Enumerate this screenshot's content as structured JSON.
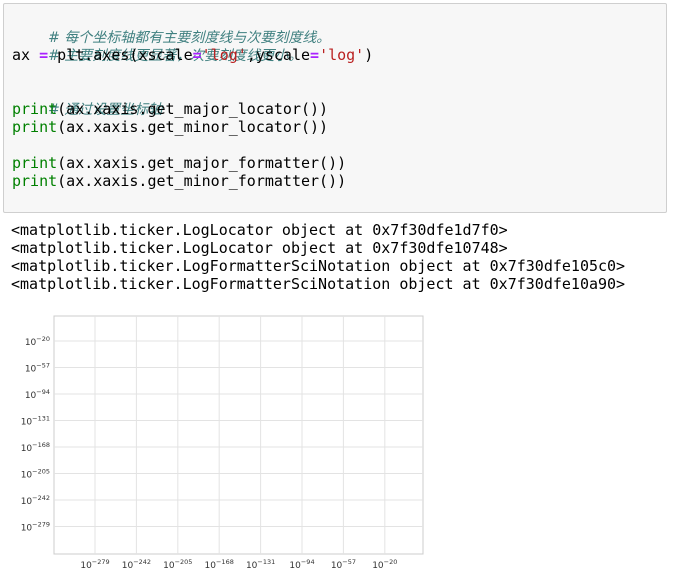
{
  "code": {
    "comment1": "# 每个坐标轴都有主要刻度线与次要刻度线。",
    "comment2": "# 主要刻度线更显著，次要刻度线更小。",
    "line3_a": "ax ",
    "line3_eq": "=",
    "line3_b": " plt.axes(xscale",
    "line3_eq2": "=",
    "line3_s1": "'log'",
    "line3_c": ",yscale",
    "line3_eq3": "=",
    "line3_s2": "'log'",
    "line3_d": ")",
    "comment3": "# 通过设置坐标轴",
    "print_kw": "print",
    "p1_rest": "(ax.xaxis.get_major_locator())",
    "p2_rest": "(ax.xaxis.get_minor_locator())",
    "p3_rest": "(ax.xaxis.get_major_formatter())",
    "p4_rest": "(ax.xaxis.get_minor_formatter())"
  },
  "output": [
    "<matplotlib.ticker.LogLocator object at 0x7f30dfe1d7f0>",
    "<matplotlib.ticker.LogLocator object at 0x7f30dfe10748>",
    "<matplotlib.ticker.LogFormatterSciNotation object at 0x7f30dfe105c0>",
    "<matplotlib.ticker.LogFormatterSciNotation object at 0x7f30dfe10a90>"
  ],
  "chart_data": {
    "type": "line",
    "xscale": "log",
    "yscale": "log",
    "grid": true,
    "series": [],
    "tick_base": "10",
    "x_tick_exponents": [
      "-279",
      "-242",
      "-205",
      "-168",
      "-131",
      "-94",
      "-57",
      "-20"
    ],
    "y_tick_exponents": [
      "-20",
      "-57",
      "-94",
      "-131",
      "-168",
      "-205",
      "-242",
      "-279"
    ]
  }
}
